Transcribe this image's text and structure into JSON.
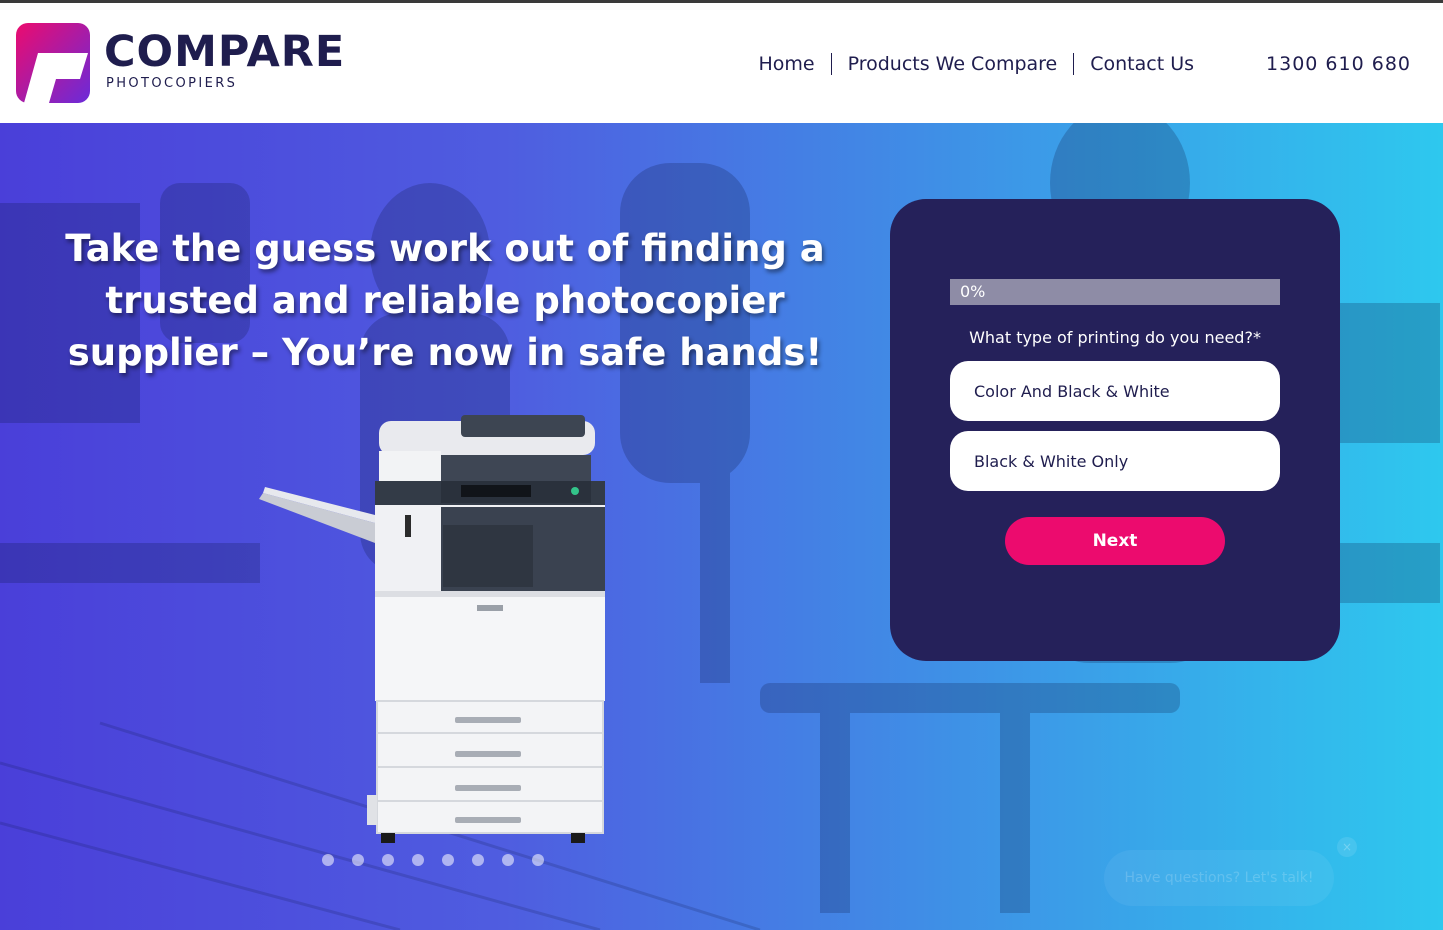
{
  "brand": {
    "name": "COMPARE",
    "tagline": "PHOTOCOPIERS",
    "colors": {
      "navy": "#1f1d4e",
      "magenta": "#ec0b6e",
      "purple": "#6a2bd9"
    }
  },
  "nav": {
    "items": [
      {
        "label": "Home"
      },
      {
        "label": "Products We Compare"
      },
      {
        "label": "Contact Us"
      }
    ],
    "phone": "1300 610 680"
  },
  "hero": {
    "headline": "Take the guess work out of finding a trusted and reliable photocopier supplier – You’re now in safe hands!",
    "slider_dot_count": 8,
    "image": "photocopier-image"
  },
  "form": {
    "progress": {
      "value": 0,
      "label": "0%"
    },
    "question": "What type of printing do you need?*",
    "options": [
      {
        "label": "Color And Black & White"
      },
      {
        "label": "Black & White Only"
      }
    ],
    "next_label": "Next",
    "colors": {
      "card": "#25215a",
      "button": "#ec0b6e"
    }
  },
  "chat": {
    "prompt": "Have questions? Let's talk!",
    "close": "×"
  }
}
